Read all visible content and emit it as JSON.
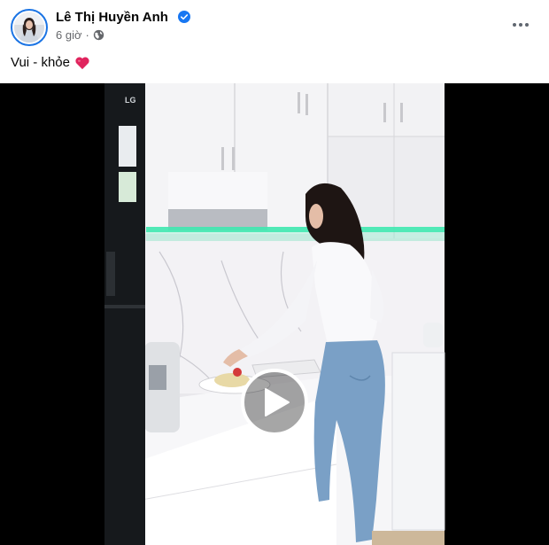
{
  "post": {
    "author": {
      "name": "Lê Thị Huyền Anh",
      "verified": true,
      "avatar_icon": "avatar-photo"
    },
    "meta": {
      "time": "6 giờ",
      "separator": "·",
      "privacy_icon": "globe-icon"
    },
    "more_icon": "more-horizontal-icon",
    "caption": {
      "text": "Vui - khỏe",
      "emoji": "red-heart-icon"
    },
    "video": {
      "play_icon": "play-icon",
      "appliance_brand": "LG"
    }
  },
  "colors": {
    "verified_blue": "#1877f2",
    "meta_gray": "#65676b",
    "heart_red": "#e0245e",
    "led_green": "#3fe8b0"
  }
}
